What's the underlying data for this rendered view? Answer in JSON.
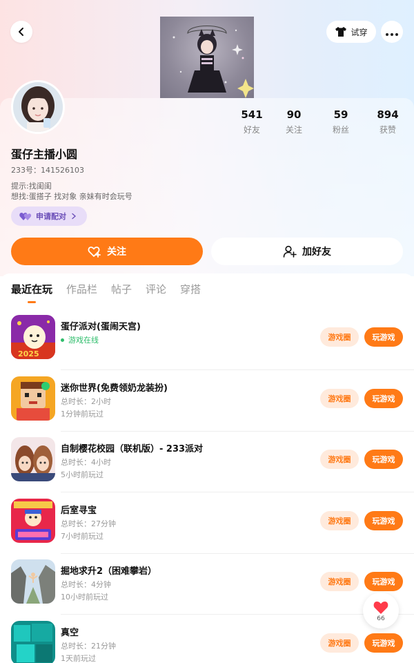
{
  "header": {
    "back_icon": "chevron-left-icon",
    "tryon_label": "试穿",
    "more_icon": "more-dots-icon"
  },
  "profile": {
    "nickname": "蛋仔主播小圆",
    "uid": "233号：141526103",
    "tip_line1": "提示:找闺闺",
    "tip_line2": "想找:蛋搭子 找对象 亲妹有时会玩号",
    "pair_label": "申请配对",
    "stats": [
      {
        "num": "541",
        "label": "好友"
      },
      {
        "num": "90",
        "label": "关注"
      },
      {
        "num": "59",
        "label": "粉丝"
      },
      {
        "num": "894",
        "label": "获赞"
      }
    ],
    "follow_label": "关注",
    "add_friend_label": "加好友"
  },
  "tabs": [
    {
      "label": "最近在玩",
      "active": true
    },
    {
      "label": "作品栏",
      "active": false
    },
    {
      "label": "帖子",
      "active": false
    },
    {
      "label": "评论",
      "active": false
    },
    {
      "label": "穿搭",
      "active": false
    }
  ],
  "games": [
    {
      "title": "蛋仔派对(蛋闹天宫)",
      "online": "游戏在线",
      "line1": "",
      "line2": "",
      "circle": "游戏圈",
      "play": "玩游戏"
    },
    {
      "title": "迷你世界(免费领奶龙装扮)",
      "online": "",
      "line1": "总时长：2小时",
      "line2": "1分钟前玩过",
      "circle": "游戏圈",
      "play": "玩游戏"
    },
    {
      "title": "自制樱花校园（联机版）- 233派对",
      "online": "",
      "line1": "总时长：4小时",
      "line2": "5小时前玩过",
      "circle": "游戏圈",
      "play": "玩游戏"
    },
    {
      "title": "后室寻宝",
      "online": "",
      "line1": "总时长：27分钟",
      "line2": "7小时前玩过",
      "circle": "游戏圈",
      "play": "玩游戏"
    },
    {
      "title": "掘地求升2（困难攀岩）",
      "online": "",
      "line1": "总时长：4分钟",
      "line2": "10小时前玩过",
      "circle": "游戏圈",
      "play": "玩游戏"
    },
    {
      "title": "真空",
      "online": "",
      "line1": "总时长：21分钟",
      "line2": "1天前玩过",
      "circle": "游戏圈",
      "play": "玩游戏"
    }
  ],
  "like_float": {
    "count": "66"
  },
  "colors": {
    "accent": "#ff7a16",
    "online": "#2ebd6b",
    "pair": "#6b4fb8"
  }
}
